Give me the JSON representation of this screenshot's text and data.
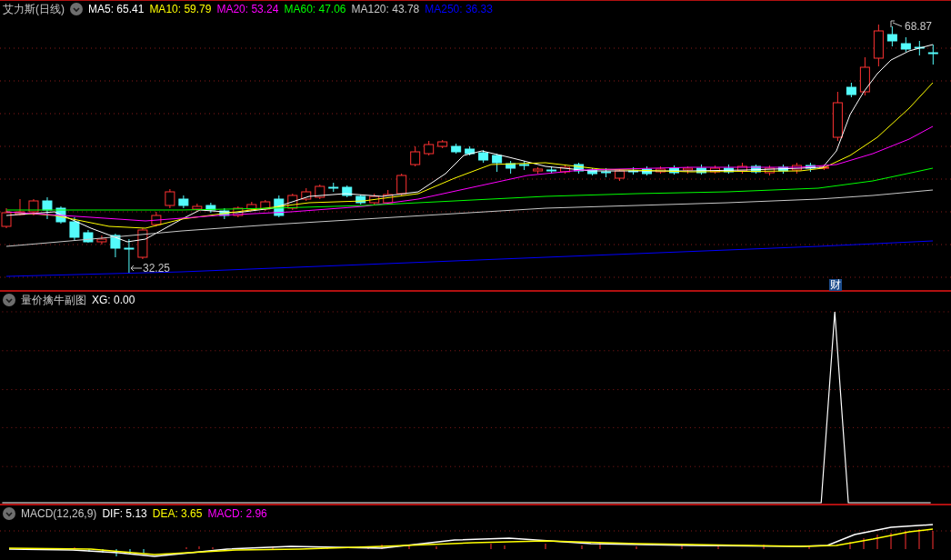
{
  "main_panel": {
    "title": "艾力斯(日线)",
    "indicators": [
      {
        "label": "MA5: 65.41",
        "color": "#ffffff"
      },
      {
        "label": "MA10: 59.79",
        "color": "#ffff00"
      },
      {
        "label": "MA20: 53.24",
        "color": "#ff00ff"
      },
      {
        "label": "MA60: 47.06",
        "color": "#00ff00"
      },
      {
        "label": "MA120: 43.78",
        "color": "#c8c8c8"
      },
      {
        "label": "MA250: 36.33",
        "color": "#0000ff"
      }
    ],
    "high_label": "68.87",
    "low_label": "32.25",
    "event_marker": "财"
  },
  "sub_panel": {
    "title": "量价擒牛副图",
    "indicators": [
      {
        "label": "XG: 0.00",
        "color": "#ffffff"
      }
    ]
  },
  "macd_panel": {
    "title": "MACD(12,26,9)",
    "indicators": [
      {
        "label": "DIF: 5.13",
        "color": "#ffffff"
      },
      {
        "label": "DEA: 3.65",
        "color": "#ffff00"
      },
      {
        "label": "MACD: 2.96",
        "color": "#ff00ff"
      }
    ]
  }
}
